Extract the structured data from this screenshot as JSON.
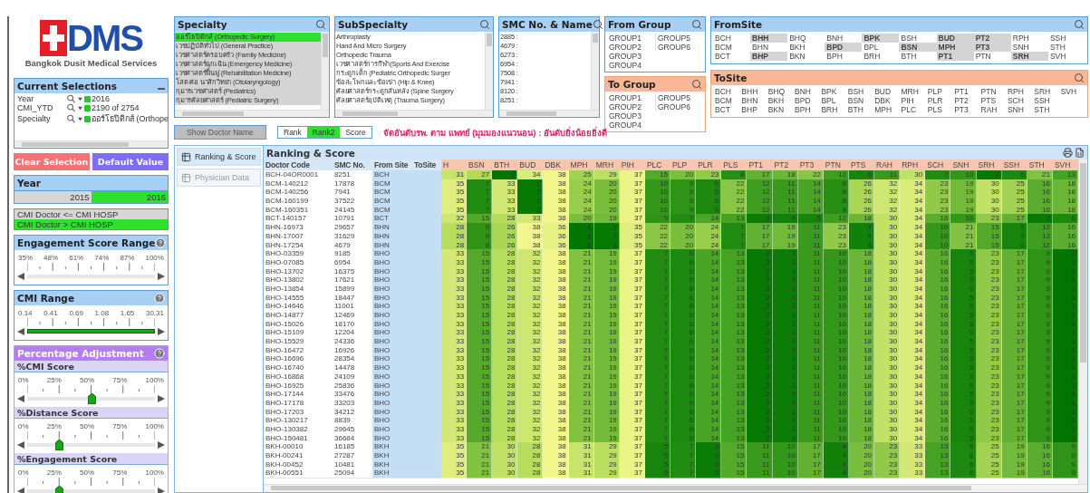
{
  "logo": {
    "mark": "DMS",
    "subtitle": "Bangkok Dusit Medical Services"
  },
  "current_selections": {
    "title": "Current Selections",
    "rows": [
      {
        "field": "Year",
        "value": "2016"
      },
      {
        "field": "CMI_YTD",
        "value": "2190 of 2754"
      },
      {
        "field": "Specialty",
        "value": "ออร์โธปิดิกส์ (Orthope"
      }
    ]
  },
  "actions": [
    {
      "label": "Clear Selection",
      "kind": "clear"
    },
    {
      "label": "Default Value",
      "kind": "default"
    }
  ],
  "year": {
    "title": "Year",
    "items": [
      {
        "label": "2015",
        "selected": false
      },
      {
        "label": "2016",
        "selected": true
      }
    ]
  },
  "cmi_filter": {
    "items": [
      {
        "label": "CMI Doctor <= CMI HOSP",
        "selected": false
      },
      {
        "label": "CMI Doctor > CMI HOSP",
        "selected": true
      }
    ]
  },
  "engagement_range": {
    "title": "Engagement Score Range",
    "ticks": [
      "35%",
      "48%",
      "61%",
      "74%",
      "87%",
      "100%"
    ]
  },
  "cmi_range": {
    "title": "CMI Range",
    "ticks": [
      "0.14",
      "0.41",
      "0.69",
      "1.08",
      "1.65",
      "30.31"
    ],
    "level": 1
  },
  "percentage_adjustment": {
    "title": "Percentage Adjustment",
    "sliders": [
      {
        "title": "%CMI Score",
        "ticks": [
          "0%",
          "25%",
          "50%",
          "75%",
          "100%"
        ],
        "level": 0.5
      },
      {
        "title": "%Distance Score",
        "ticks": [
          "0%",
          "25%",
          "50%",
          "75%",
          "100%"
        ],
        "level": 0.25
      },
      {
        "title": "%Engagement Score",
        "ticks": [
          "0%",
          "25%",
          "50%",
          "75%",
          "100%"
        ],
        "level": 0.25
      }
    ]
  },
  "specialty": {
    "title": "Specialty",
    "items": [
      {
        "label": "ออร์โธปิดิกส์ (Orthopedic Surgery)",
        "selected": true,
        "excluded": false
      },
      {
        "label": "เวชปฏิบัติทั่วไป (General Practice)",
        "selected": false,
        "excluded": true
      },
      {
        "label": "เวชศาสตร์ครอบครัว (Family Medicine)",
        "selected": false,
        "excluded": true
      },
      {
        "label": "เวชศาสตร์ฉุกเฉิน (Emergency Medicine)",
        "selected": false,
        "excluded": true
      },
      {
        "label": "เวชศาสตร์ฟื้นฟู (Rehabilitation Medicine)",
        "selected": false,
        "excluded": true
      },
      {
        "label": "โสต ศอ นาสิกวิทยา (Otolaryngology)",
        "selected": false,
        "excluded": true
      },
      {
        "label": "กุมารเวชศาสตร์ (Pediatrics)",
        "selected": false,
        "excluded": true
      },
      {
        "label": "กุมารศัลยศาสตร์ (Pediatric Surgery)",
        "selected": false,
        "excluded": true
      }
    ]
  },
  "subspecialty": {
    "title": "SubSpecialty",
    "items": [
      {
        "label": "Arthroplasty",
        "selected": false,
        "excluded": false
      },
      {
        "label": "Hand And Micro Surgery",
        "selected": false,
        "excluded": false
      },
      {
        "label": "Orthopedic Trauma",
        "selected": false,
        "excluded": false
      },
      {
        "label": "เวชศาสตร์การกีฬา(Sports And Exercise",
        "selected": false,
        "excluded": false
      },
      {
        "label": "กระดูกเด็ก (Pediatric Orthopedic Surger",
        "selected": false,
        "excluded": false
      },
      {
        "label": "ข้อสะโพกและข้อเข่า (Hip & Knee)",
        "selected": false,
        "excluded": false
      },
      {
        "label": "ศัลยศาสตร์กระดูกสันหลัง (Spine Surgery",
        "selected": false,
        "excluded": false
      },
      {
        "label": "ศัลยศาสตร์อุบัติเหตุ (Trauma Surgery)",
        "selected": false,
        "excluded": false
      }
    ]
  },
  "smc": {
    "title": "SMC No. & Name",
    "items": [
      {
        "label": "2885 :",
        "selected": false,
        "excluded": false
      },
      {
        "label": "4679 :",
        "selected": false,
        "excluded": false
      },
      {
        "label": "6273 :",
        "selected": false,
        "excluded": false
      },
      {
        "label": "6954 :",
        "selected": false,
        "excluded": false
      },
      {
        "label": "7508 :",
        "selected": false,
        "excluded": false
      },
      {
        "label": "7941 :",
        "selected": false,
        "excluded": false
      },
      {
        "label": "8120 :",
        "selected": false,
        "excluded": false
      },
      {
        "label": "8251 :",
        "selected": false,
        "excluded": false
      }
    ]
  },
  "from_group": {
    "title": "From Group",
    "items": [
      {
        "label": "GROUP1",
        "selected": false,
        "excluded": false
      },
      {
        "label": "GROUP2",
        "selected": false,
        "excluded": false
      },
      {
        "label": "GROUP3",
        "selected": false,
        "excluded": false
      },
      {
        "label": "GROUP4",
        "selected": false,
        "excluded": false
      },
      {
        "label": "GROUP5",
        "selected": false,
        "excluded": false
      },
      {
        "label": "GROUP6",
        "selected": false,
        "excluded": false
      }
    ]
  },
  "to_group": {
    "title": "To Group",
    "items": [
      {
        "label": "GROUP1",
        "selected": false,
        "excluded": false
      },
      {
        "label": "GROUP2",
        "selected": false,
        "excluded": false
      },
      {
        "label": "GROUP3",
        "selected": false,
        "excluded": false
      },
      {
        "label": "GROUP4",
        "selected": false,
        "excluded": false
      },
      {
        "label": "GROUP5",
        "selected": false,
        "excluded": false
      },
      {
        "label": "GROUP6",
        "selected": false,
        "excluded": false
      }
    ]
  },
  "from_site": {
    "title": "FromSite",
    "items": [
      {
        "label": "BCH",
        "selected": false,
        "excluded": false
      },
      {
        "label": "BCM",
        "selected": false,
        "excluded": false
      },
      {
        "label": "BCT",
        "selected": false,
        "excluded": false
      },
      {
        "label": "BHH",
        "selected": false,
        "excluded": true
      },
      {
        "label": "BHN",
        "selected": false,
        "excluded": false
      },
      {
        "label": "BHP",
        "selected": false,
        "excluded": true
      },
      {
        "label": "BHQ",
        "selected": false,
        "excluded": false
      },
      {
        "label": "BKH",
        "selected": false,
        "excluded": false
      },
      {
        "label": "BKN",
        "selected": false,
        "excluded": false
      },
      {
        "label": "BNH",
        "selected": false,
        "excluded": false
      },
      {
        "label": "BPD",
        "selected": false,
        "excluded": true
      },
      {
        "label": "BPH",
        "selected": false,
        "excluded": false
      },
      {
        "label": "BPK",
        "selected": false,
        "excluded": true
      },
      {
        "label": "BPL",
        "selected": false,
        "excluded": false
      },
      {
        "label": "BRH",
        "selected": false,
        "excluded": false
      },
      {
        "label": "BSH",
        "selected": false,
        "excluded": false
      },
      {
        "label": "BSN",
        "selected": false,
        "excluded": true
      },
      {
        "label": "BTH",
        "selected": false,
        "excluded": false
      },
      {
        "label": "BUD",
        "selected": false,
        "excluded": true
      },
      {
        "label": "MPH",
        "selected": false,
        "excluded": true
      },
      {
        "label": "PT1",
        "selected": false,
        "excluded": true
      },
      {
        "label": "PT2",
        "selected": false,
        "excluded": true
      },
      {
        "label": "PT3",
        "selected": false,
        "excluded": true
      },
      {
        "label": "PTN",
        "selected": false,
        "excluded": false
      },
      {
        "label": "RPH",
        "selected": false,
        "excluded": false
      },
      {
        "label": "SNH",
        "selected": false,
        "excluded": false
      },
      {
        "label": "SRH",
        "selected": false,
        "excluded": true
      },
      {
        "label": "SSH",
        "selected": false,
        "excluded": false
      },
      {
        "label": "STH",
        "selected": false,
        "excluded": false
      },
      {
        "label": "SVH",
        "selected": false,
        "excluded": false
      }
    ]
  },
  "to_site": {
    "title": "ToSite",
    "items": [
      {
        "label": "BCH",
        "selected": false,
        "excluded": false
      },
      {
        "label": "BCM",
        "selected": false,
        "excluded": false
      },
      {
        "label": "BCT",
        "selected": false,
        "excluded": false
      },
      {
        "label": "BHH",
        "selected": false,
        "excluded": false
      },
      {
        "label": "BHN",
        "selected": false,
        "excluded": false
      },
      {
        "label": "BHP",
        "selected": false,
        "excluded": false
      },
      {
        "label": "BHQ",
        "selected": false,
        "excluded": false
      },
      {
        "label": "BKH",
        "selected": false,
        "excluded": false
      },
      {
        "label": "BKN",
        "selected": false,
        "excluded": false
      },
      {
        "label": "BNH",
        "selected": false,
        "excluded": false
      },
      {
        "label": "BPD",
        "selected": false,
        "excluded": false
      },
      {
        "label": "BPH",
        "selected": false,
        "excluded": false
      },
      {
        "label": "BPK",
        "selected": false,
        "excluded": false
      },
      {
        "label": "BPL",
        "selected": false,
        "excluded": false
      },
      {
        "label": "BRH",
        "selected": false,
        "excluded": false
      },
      {
        "label": "BSH",
        "selected": false,
        "excluded": false
      },
      {
        "label": "BSN",
        "selected": false,
        "excluded": false
      },
      {
        "label": "BTH",
        "selected": false,
        "excluded": false
      },
      {
        "label": "BUD",
        "selected": false,
        "excluded": false
      },
      {
        "label": "DBK",
        "selected": false,
        "excluded": false
      },
      {
        "label": "MPH",
        "selected": false,
        "excluded": false
      },
      {
        "label": "MRH",
        "selected": false,
        "excluded": false
      },
      {
        "label": "PIH",
        "selected": false,
        "excluded": false
      },
      {
        "label": "PLC",
        "selected": false,
        "excluded": false
      },
      {
        "label": "PLP",
        "selected": false,
        "excluded": false
      },
      {
        "label": "PLR",
        "selected": false,
        "excluded": false
      },
      {
        "label": "PLS",
        "selected": false,
        "excluded": false
      },
      {
        "label": "PT1",
        "selected": false,
        "excluded": false
      },
      {
        "label": "PT2",
        "selected": false,
        "excluded": false
      },
      {
        "label": "PT3",
        "selected": false,
        "excluded": false
      },
      {
        "label": "PTN",
        "selected": false,
        "excluded": false
      },
      {
        "label": "PTS",
        "selected": false,
        "excluded": false
      },
      {
        "label": "RAH",
        "selected": false,
        "excluded": false
      },
      {
        "label": "RPH",
        "selected": false,
        "excluded": false
      },
      {
        "label": "SCH",
        "selected": false,
        "excluded": false
      },
      {
        "label": "SNH",
        "selected": false,
        "excluded": false
      },
      {
        "label": "SRH",
        "selected": false,
        "excluded": false
      },
      {
        "label": "SSH",
        "selected": false,
        "excluded": false
      },
      {
        "label": "STH",
        "selected": false,
        "excluded": false
      },
      {
        "label": "SVH",
        "selected": false,
        "excluded": false
      }
    ]
  },
  "show_doctor_name": {
    "label": "Show Doctor Name"
  },
  "view_mode": [
    {
      "label": "Rank",
      "selected": false
    },
    {
      "label": "Rank2",
      "selected": true
    },
    {
      "label": "Score",
      "selected": false
    }
  ],
  "note": "จัดอันดับรพ. ตาม แพทย์ (มุมมองแนวนอน) : อันดับยิ่งน้อยยิ่งดี",
  "tabs": [
    {
      "label": "Ranking & Score",
      "selected": true
    },
    {
      "label": "Physician Data",
      "selected": false
    }
  ],
  "ranking": {
    "title": "Ranking & Score",
    "columns": [
      "Doctor Code",
      "SMC No.",
      "From Site",
      "ToSite"
    ],
    "site_columns": [
      "H",
      "BSN",
      "BTH",
      "BUD",
      "DBK",
      "MPH",
      "MRH",
      "PIH",
      "PLC",
      "PLP",
      "PLR",
      "PLS",
      "PT1",
      "PT2",
      "PT3",
      "PTN",
      "PTS",
      "RAH",
      "RPH",
      "SCH",
      "SNH",
      "SRH",
      "SSH",
      "STH",
      "SVH"
    ],
    "rows": [
      {
        "doctor_code": "BCH-04OR0001",
        "smc_no": "8251",
        "from_site": "BCH",
        "ranks": [
          "31",
          "27",
          "1",
          "34",
          "38",
          "25",
          "29",
          "37",
          "15",
          "20",
          "23",
          "8",
          "17",
          "18",
          "22",
          "12",
          "5",
          "11",
          "30",
          "7",
          "10",
          "2",
          "6",
          "21",
          "13"
        ]
      },
      {
        "doctor_code": "BCM-140212",
        "smc_no": "17878",
        "from_site": "BCM",
        "ranks": [
          "35",
          "7",
          "33",
          "2",
          "38",
          "24",
          "20",
          "37",
          "10",
          "9",
          "6",
          "22",
          "12",
          "11",
          "14",
          "8",
          "26",
          "32",
          "34",
          "23",
          "19",
          "30",
          "25",
          "16",
          "18"
        ]
      },
      {
        "doctor_code": "BCM-140256",
        "smc_no": "7941",
        "from_site": "BCM",
        "ranks": [
          "35",
          "7",
          "33",
          "2",
          "38",
          "24",
          "20",
          "37",
          "10",
          "9",
          "6",
          "22",
          "12",
          "11",
          "14",
          "8",
          "26",
          "32",
          "34",
          "23",
          "19",
          "30",
          "25",
          "16",
          "18"
        ]
      },
      {
        "doctor_code": "BCM-160199",
        "smc_no": "37522",
        "from_site": "BCM",
        "ranks": [
          "35",
          "7",
          "33",
          "2",
          "38",
          "24",
          "20",
          "37",
          "10",
          "9",
          "6",
          "22",
          "12",
          "11",
          "14",
          "8",
          "26",
          "32",
          "34",
          "23",
          "19",
          "30",
          "25",
          "16",
          "18"
        ]
      },
      {
        "doctor_code": "BCM-160351",
        "smc_no": "24145",
        "from_site": "BCM",
        "ranks": [
          "35",
          "7",
          "33",
          "2",
          "38",
          "24",
          "20",
          "37",
          "10",
          "9",
          "6",
          "22",
          "12",
          "11",
          "14",
          "8",
          "26",
          "32",
          "34",
          "23",
          "19",
          "30",
          "25",
          "16",
          "18"
        ]
      },
      {
        "doctor_code": "BCT-140157",
        "smc_no": "10791",
        "from_site": "BCT",
        "ranks": [
          "32",
          "15",
          "28",
          "33",
          "38",
          "20",
          "19",
          "37",
          "9",
          "7",
          "14",
          "13",
          "3",
          "4",
          "5",
          "12",
          "18",
          "30",
          "34",
          "16",
          "10",
          "23",
          "17",
          "2",
          "6"
        ]
      },
      {
        "doctor_code": "BHN-16973",
        "smc_no": "29657",
        "from_site": "BHN",
        "ranks": [
          "28",
          "9",
          "26",
          "38",
          "36",
          "1",
          "2",
          "35",
          "22",
          "20",
          "24",
          "7",
          "17",
          "19",
          "11",
          "23",
          "4",
          "30",
          "34",
          "10",
          "21",
          "15",
          "5",
          "12",
          "16"
        ]
      },
      {
        "doctor_code": "BHN-17007",
        "smc_no": "31629",
        "from_site": "BHN",
        "ranks": [
          "28",
          "9",
          "26",
          "38",
          "36",
          "1",
          "2",
          "35",
          "22",
          "20",
          "24",
          "7",
          "17",
          "19",
          "11",
          "23",
          "4",
          "30",
          "34",
          "10",
          "21",
          "15",
          "5",
          "12",
          "16"
        ]
      },
      {
        "doctor_code": "BHN-17254",
        "smc_no": "4679",
        "from_site": "BHN",
        "ranks": [
          "28",
          "9",
          "26",
          "38",
          "36",
          "1",
          "2",
          "35",
          "22",
          "20",
          "24",
          "7",
          "17",
          "19",
          "11",
          "23",
          "4",
          "30",
          "34",
          "10",
          "21",
          "15",
          "5",
          "12",
          "16"
        ]
      },
      {
        "doctor_code": "BHO-03359",
        "smc_no": "9185",
        "from_site": "BHO",
        "ranks": [
          "33",
          "15",
          "28",
          "32",
          "38",
          "21",
          "19",
          "37",
          "7",
          "6",
          "14",
          "13",
          "2",
          "3",
          "11",
          "10",
          "18",
          "30",
          "34",
          "16",
          "5",
          "23",
          "17",
          "9",
          "1"
        ]
      },
      {
        "doctor_code": "BHO-07085",
        "smc_no": "6954",
        "from_site": "BHO",
        "ranks": [
          "33",
          "15",
          "28",
          "32",
          "38",
          "21",
          "19",
          "37",
          "7",
          "6",
          "14",
          "13",
          "2",
          "3",
          "11",
          "10",
          "18",
          "30",
          "34",
          "16",
          "5",
          "23",
          "17",
          "9",
          "1"
        ]
      },
      {
        "doctor_code": "BHO-13702",
        "smc_no": "16375",
        "from_site": "BHO",
        "ranks": [
          "33",
          "15",
          "28",
          "32",
          "38",
          "21",
          "19",
          "37",
          "7",
          "6",
          "14",
          "13",
          "2",
          "3",
          "11",
          "10",
          "18",
          "30",
          "34",
          "16",
          "5",
          "23",
          "17",
          "9",
          "1"
        ]
      },
      {
        "doctor_code": "BHO-13802",
        "smc_no": "17621",
        "from_site": "BHO",
        "ranks": [
          "33",
          "15",
          "28",
          "32",
          "38",
          "21",
          "19",
          "37",
          "7",
          "6",
          "14",
          "13",
          "2",
          "3",
          "11",
          "10",
          "18",
          "30",
          "34",
          "16",
          "5",
          "23",
          "17",
          "9",
          "1"
        ]
      },
      {
        "doctor_code": "BHO-13854",
        "smc_no": "15899",
        "from_site": "BHO",
        "ranks": [
          "33",
          "15",
          "28",
          "32",
          "38",
          "21",
          "19",
          "37",
          "7",
          "6",
          "14",
          "13",
          "2",
          "3",
          "11",
          "10",
          "18",
          "30",
          "34",
          "16",
          "5",
          "23",
          "17",
          "9",
          "1"
        ]
      },
      {
        "doctor_code": "BHO-14555",
        "smc_no": "18447",
        "from_site": "BHO",
        "ranks": [
          "33",
          "15",
          "28",
          "32",
          "38",
          "21",
          "19",
          "37",
          "7",
          "6",
          "14",
          "13",
          "2",
          "3",
          "11",
          "10",
          "18",
          "30",
          "34",
          "16",
          "5",
          "23",
          "17",
          "9",
          "1"
        ]
      },
      {
        "doctor_code": "BHO-14646",
        "smc_no": "11001",
        "from_site": "BHO",
        "ranks": [
          "33",
          "15",
          "28",
          "32",
          "38",
          "21",
          "19",
          "37",
          "7",
          "6",
          "14",
          "13",
          "2",
          "3",
          "11",
          "10",
          "18",
          "30",
          "34",
          "16",
          "5",
          "23",
          "17",
          "9",
          "1"
        ]
      },
      {
        "doctor_code": "BHO-14877",
        "smc_no": "12469",
        "from_site": "BHO",
        "ranks": [
          "33",
          "15",
          "28",
          "32",
          "38",
          "21",
          "19",
          "37",
          "7",
          "6",
          "14",
          "13",
          "2",
          "3",
          "11",
          "10",
          "18",
          "30",
          "34",
          "16",
          "5",
          "23",
          "17",
          "9",
          "1"
        ]
      },
      {
        "doctor_code": "BHO-15026",
        "smc_no": "18170",
        "from_site": "BHO",
        "ranks": [
          "33",
          "15",
          "28",
          "32",
          "38",
          "21",
          "19",
          "37",
          "7",
          "6",
          "14",
          "13",
          "2",
          "3",
          "11",
          "10",
          "18",
          "30",
          "34",
          "16",
          "5",
          "23",
          "17",
          "9",
          "1"
        ]
      },
      {
        "doctor_code": "BHO-15109",
        "smc_no": "12204",
        "from_site": "BHO",
        "ranks": [
          "33",
          "15",
          "28",
          "32",
          "38",
          "21",
          "19",
          "37",
          "7",
          "6",
          "14",
          "13",
          "2",
          "3",
          "11",
          "10",
          "18",
          "30",
          "34",
          "16",
          "5",
          "23",
          "17",
          "9",
          "1"
        ]
      },
      {
        "doctor_code": "BHO-15529",
        "smc_no": "24336",
        "from_site": "BHO",
        "ranks": [
          "33",
          "15",
          "28",
          "32",
          "38",
          "21",
          "19",
          "37",
          "7",
          "6",
          "14",
          "13",
          "2",
          "3",
          "11",
          "10",
          "18",
          "30",
          "34",
          "16",
          "5",
          "23",
          "17",
          "9",
          "1"
        ]
      },
      {
        "doctor_code": "BHO-16472",
        "smc_no": "16926",
        "from_site": "BHO",
        "ranks": [
          "33",
          "15",
          "28",
          "32",
          "38",
          "21",
          "19",
          "37",
          "7",
          "6",
          "14",
          "13",
          "2",
          "3",
          "11",
          "10",
          "18",
          "30",
          "34",
          "16",
          "5",
          "23",
          "17",
          "9",
          "1"
        ]
      },
      {
        "doctor_code": "BHO-16696",
        "smc_no": "28354",
        "from_site": "BHO",
        "ranks": [
          "33",
          "15",
          "28",
          "32",
          "38",
          "21",
          "19",
          "37",
          "7",
          "6",
          "14",
          "13",
          "2",
          "3",
          "11",
          "10",
          "18",
          "30",
          "34",
          "16",
          "5",
          "23",
          "17",
          "9",
          "1"
        ]
      },
      {
        "doctor_code": "BHO-16740",
        "smc_no": "14478",
        "from_site": "BHO",
        "ranks": [
          "33",
          "15",
          "28",
          "32",
          "38",
          "21",
          "19",
          "37",
          "7",
          "6",
          "14",
          "13",
          "2",
          "3",
          "11",
          "10",
          "18",
          "30",
          "34",
          "16",
          "5",
          "23",
          "17",
          "9",
          "1"
        ]
      },
      {
        "doctor_code": "BHO-16868",
        "smc_no": "24109",
        "from_site": "BHO",
        "ranks": [
          "33",
          "15",
          "28",
          "32",
          "38",
          "21",
          "19",
          "37",
          "7",
          "6",
          "14",
          "13",
          "2",
          "3",
          "11",
          "10",
          "18",
          "30",
          "34",
          "16",
          "5",
          "23",
          "17",
          "9",
          "1"
        ]
      },
      {
        "doctor_code": "BHO-16925",
        "smc_no": "25836",
        "from_site": "BHO",
        "ranks": [
          "33",
          "15",
          "28",
          "32",
          "38",
          "21",
          "19",
          "37",
          "7",
          "6",
          "14",
          "13",
          "2",
          "3",
          "11",
          "10",
          "18",
          "30",
          "34",
          "16",
          "5",
          "23",
          "17",
          "9",
          "1"
        ]
      },
      {
        "doctor_code": "BHO-17144",
        "smc_no": "33476",
        "from_site": "BHO",
        "ranks": [
          "33",
          "15",
          "28",
          "32",
          "38",
          "21",
          "19",
          "37",
          "7",
          "6",
          "14",
          "13",
          "2",
          "3",
          "11",
          "10",
          "18",
          "30",
          "34",
          "16",
          "5",
          "23",
          "17",
          "9",
          "1"
        ]
      },
      {
        "doctor_code": "BHO-17178",
        "smc_no": "33203",
        "from_site": "BHO",
        "ranks": [
          "33",
          "15",
          "28",
          "32",
          "38",
          "21",
          "19",
          "37",
          "7",
          "6",
          "14",
          "13",
          "2",
          "3",
          "11",
          "10",
          "18",
          "30",
          "34",
          "16",
          "5",
          "23",
          "17",
          "9",
          "1"
        ]
      },
      {
        "doctor_code": "BHO-17203",
        "smc_no": "34212",
        "from_site": "BHO",
        "ranks": [
          "33",
          "15",
          "28",
          "32",
          "38",
          "21",
          "19",
          "37",
          "7",
          "6",
          "14",
          "13",
          "2",
          "3",
          "11",
          "10",
          "18",
          "30",
          "34",
          "16",
          "5",
          "23",
          "17",
          "9",
          "1"
        ]
      },
      {
        "doctor_code": "BHO-130217",
        "smc_no": "8839",
        "from_site": "BHO",
        "ranks": [
          "33",
          "15",
          "28",
          "32",
          "38",
          "21",
          "19",
          "37",
          "7",
          "6",
          "14",
          "13",
          "2",
          "3",
          "11",
          "10",
          "18",
          "30",
          "34",
          "16",
          "5",
          "23",
          "17",
          "9",
          "1"
        ]
      },
      {
        "doctor_code": "BHO-130382",
        "smc_no": "29645",
        "from_site": "BHO",
        "ranks": [
          "33",
          "15",
          "28",
          "32",
          "38",
          "21",
          "19",
          "37",
          "7",
          "6",
          "14",
          "13",
          "2",
          "3",
          "11",
          "10",
          "18",
          "30",
          "34",
          "16",
          "5",
          "23",
          "17",
          "9",
          "1"
        ]
      },
      {
        "doctor_code": "BHO-150481",
        "smc_no": "36684",
        "from_site": "BHO",
        "ranks": [
          "33",
          "15",
          "28",
          "32",
          "38",
          "21",
          "19",
          "37",
          "7",
          "6",
          "14",
          "13",
          "2",
          "3",
          "11",
          "10",
          "18",
          "30",
          "34",
          "16",
          "5",
          "23",
          "17",
          "9",
          "1"
        ]
      },
      {
        "doctor_code": "BKH-00010",
        "smc_no": "16185",
        "from_site": "BKH",
        "ranks": [
          "35",
          "21",
          "30",
          "28",
          "38",
          "31",
          "29",
          "37",
          "5",
          "7",
          "3",
          "15",
          "11",
          "10",
          "17",
          "4",
          "20",
          "23",
          "33",
          "13",
          "6",
          "25",
          "19",
          "16",
          "9"
        ]
      },
      {
        "doctor_code": "BKH-00241",
        "smc_no": "27287",
        "from_site": "BKH",
        "ranks": [
          "35",
          "21",
          "30",
          "28",
          "38",
          "31",
          "29",
          "37",
          "5",
          "7",
          "3",
          "15",
          "11",
          "10",
          "17",
          "4",
          "20",
          "23",
          "33",
          "13",
          "6",
          "25",
          "19",
          "16",
          "9"
        ]
      },
      {
        "doctor_code": "BKH-00452",
        "smc_no": "10481",
        "from_site": "BKH",
        "ranks": [
          "35",
          "21",
          "30",
          "28",
          "38",
          "31",
          "29",
          "37",
          "5",
          "7",
          "3",
          "15",
          "11",
          "10",
          "17",
          "4",
          "20",
          "23",
          "33",
          "13",
          "6",
          "25",
          "19",
          "16",
          "9"
        ]
      },
      {
        "doctor_code": "BKH-00551",
        "smc_no": "25094",
        "from_site": "BKH",
        "ranks": [
          "35",
          "21",
          "30",
          "28",
          "38",
          "31",
          "29",
          "37",
          "5",
          "7",
          "3",
          "15",
          "11",
          "10",
          "17",
          "4",
          "20",
          "23",
          "33",
          "13",
          "6",
          "25",
          "19",
          "16",
          "9"
        ]
      }
    ]
  }
}
